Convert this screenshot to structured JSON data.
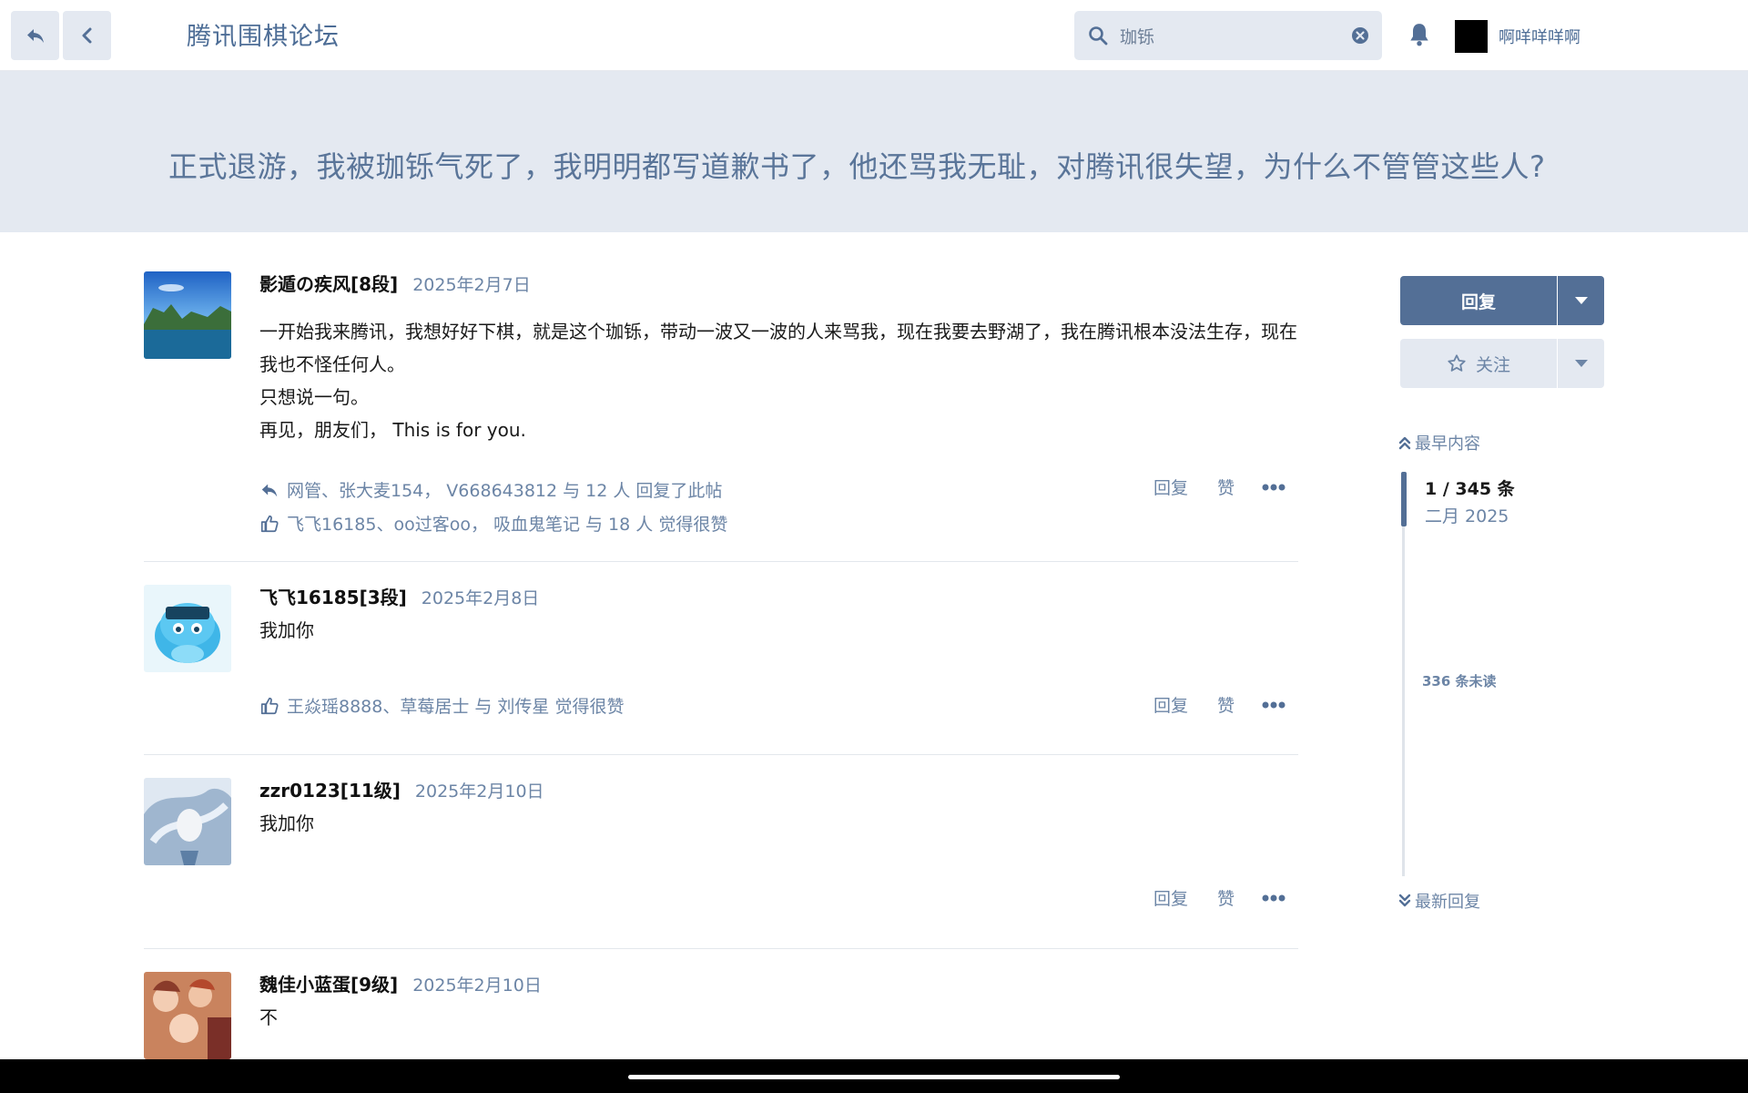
{
  "header": {
    "forum_title": "腾讯围棋论坛",
    "search_value": "珈铄",
    "username": "啊咩咩咩啊"
  },
  "topic": {
    "title": "正式退游，我被珈铄气死了，我明明都写道歉书了，他还骂我无耻，对腾讯很失望，为什么不管管这些人?"
  },
  "posts": [
    {
      "username": "影遁の疾风[8段]",
      "date": "2025年2月7日",
      "lines": [
        "一开始我来腾讯，我想好好下棋，就是这个珈铄，带动一波又一波的人来骂我，现在我要去野湖了，我在腾讯根本没法生存，现在我也不怪任何人。",
        "只想说一句。",
        "再见，朋友们， This is for you."
      ],
      "reply_label": "回复",
      "like_label": "赞",
      "replies_summary": "网管、张大麦154， V668643812 与 12 人 回复了此帖",
      "likes_summary": "飞飞16185、oo过客oo， 吸血鬼笔记 与 18 人 觉得很赞"
    },
    {
      "username": "飞飞16185[3段]",
      "date": "2025年2月8日",
      "lines": [
        "我加你"
      ],
      "reply_label": "回复",
      "like_label": "赞",
      "likes_summary": "王焱瑶8888、草莓居士 与 刘传星 觉得很赞"
    },
    {
      "username": "zzr0123[11级]",
      "date": "2025年2月10日",
      "lines": [
        "我加你"
      ],
      "reply_label": "回复",
      "like_label": "赞"
    },
    {
      "username": "魏佳小蓝蛋[9级]",
      "date": "2025年2月10日",
      "lines": [
        "不"
      ]
    }
  ],
  "sidebar": {
    "reply_button": "回复",
    "follow_button": "关注",
    "earliest_label": "最早内容",
    "post_count": "1 / 345 条",
    "month_label": "二月 2025",
    "unread_label": "336 条未读",
    "latest_label": "最新回复"
  },
  "colors": {
    "accent": "#536f96",
    "link": "#6c85a6",
    "banner_bg": "#e4e9f1"
  }
}
